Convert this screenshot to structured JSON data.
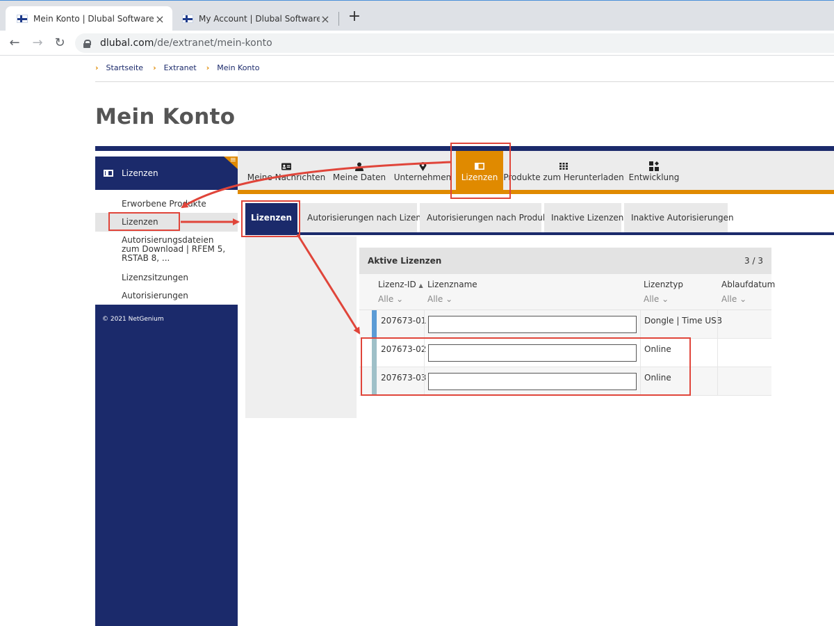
{
  "browser": {
    "tabs": [
      {
        "title": "Mein Konto | Dlubal Software",
        "active": true
      },
      {
        "title": "My Account | Dlubal Software",
        "active": false
      }
    ],
    "new_tab": "+",
    "url_host": "dlubal.com",
    "url_path": "/de/extranet/mein-konto"
  },
  "breadcrumb": [
    "Startseite",
    "Extranet",
    "Mein Konto"
  ],
  "page_title": "Mein Konto",
  "sidebar": {
    "header": "Lizenzen",
    "items": [
      {
        "label": "Erworbene Produkte",
        "active": false
      },
      {
        "label": "Lizenzen",
        "active": true
      },
      {
        "label": "Autorisierungsdateien zum Download | RFEM 5, RSTAB 8, ...",
        "active": false
      },
      {
        "label": "Lizenzsitzungen",
        "active": false
      },
      {
        "label": "Autorisierungen",
        "active": false
      }
    ],
    "copyright": "© 2021 NetGenium"
  },
  "nav_tabs": [
    {
      "label": "Meine Nachrichten",
      "icon": "id-card-icon",
      "active": false
    },
    {
      "label": "Meine Daten",
      "icon": "person-icon",
      "active": false
    },
    {
      "label": "Unternehmen",
      "icon": "location-pin-icon",
      "active": false
    },
    {
      "label": "Lizenzen",
      "icon": "license-icon",
      "active": true
    },
    {
      "label": "Produkte zum Herunterladen",
      "icon": "grid-icon",
      "active": false
    },
    {
      "label": "Entwicklung",
      "icon": "shapes-icon",
      "active": false
    }
  ],
  "sub_tabs": [
    {
      "label": "Lizenzen",
      "active": true
    },
    {
      "label": "Autorisierungen nach Lizenz",
      "active": false
    },
    {
      "label": "Autorisierungen nach Produkt",
      "active": false
    },
    {
      "label": "Inaktive Lizenzen",
      "active": false
    },
    {
      "label": "Inaktive Autorisierungen",
      "active": false
    }
  ],
  "table": {
    "title": "Aktive Lizenzen",
    "count": "3 / 3",
    "columns": [
      {
        "label": "Lizenz-ID",
        "filter": "Alle",
        "sorted": "asc"
      },
      {
        "label": "Lizenzname",
        "filter": "Alle"
      },
      {
        "label": "Lizenztyp",
        "filter": "Alle"
      },
      {
        "label": "Ablaufdatum",
        "filter": "Alle"
      }
    ],
    "rows": [
      {
        "id": "207673-01",
        "name": "",
        "type": "Dongle | Time USB",
        "expiry": "",
        "stripe_color": "#5b9bd5"
      },
      {
        "id": "207673-02",
        "name": "",
        "type": "Online",
        "expiry": "",
        "stripe_color": "#9fc0c8"
      },
      {
        "id": "207673-03",
        "name": "",
        "type": "Online",
        "expiry": "",
        "stripe_color": "#9fc0c8"
      }
    ]
  },
  "colors": {
    "navy": "#1b2a6b",
    "orange": "#e08a00",
    "annotation_red": "#e0453a"
  }
}
